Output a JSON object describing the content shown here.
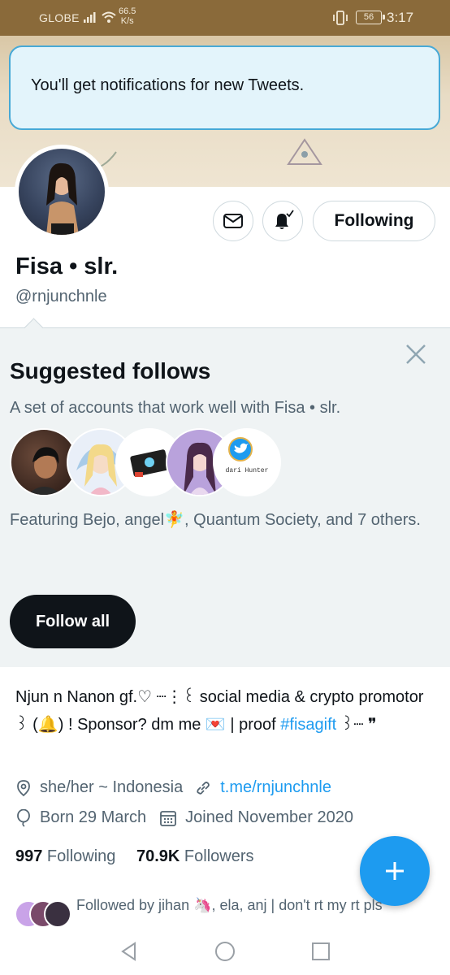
{
  "status_bar": {
    "carrier": "GLOBE",
    "speed_value": "66.5",
    "speed_unit": "K/s",
    "battery": "56",
    "time": "3:17",
    "icons": [
      "signal-icon",
      "wifi-icon",
      "vibrate-icon",
      "battery-icon"
    ]
  },
  "toast": {
    "message": "You'll get notifications for new Tweets."
  },
  "profile": {
    "display_name": "Fisa • slr.",
    "handle": "@rnjunchnle",
    "following_button": "Following"
  },
  "suggested": {
    "title": "Suggested follows",
    "description": "A set of accounts that work well with Fisa • slr.",
    "featuring": "Featuring Bejo, angel🧚, Quantum Society, and 7 others.",
    "follow_all": "Follow all",
    "face_caption": "dari Hunter"
  },
  "bio": {
    "line": "Njun n Nanon gf.♡ ┈⋮꒰ social media & crypto promotor ꒱ (🔔) ! Sponsor? dm me 💌 | proof ",
    "hashtag": "#fisagift",
    "tail": " ꒱┈ ❞"
  },
  "meta": {
    "location": "she/her ~ Indonesia",
    "link": "t.me/rnjunchnle",
    "birthday": "Born 29 March",
    "joined": "Joined November 2020"
  },
  "counts": {
    "following_num": "997",
    "following_label": " Following",
    "followers_num": "70.9K",
    "followers_label": " Followers"
  },
  "followed_by": "Followed by jihan 🦄, ela, anj | don't rt my rt pls",
  "colors": {
    "accent": "#1d9bf0",
    "status_bar": "#8a6a3a",
    "toast_bg": "#e3f4fb",
    "toast_border": "#47a9d6"
  }
}
